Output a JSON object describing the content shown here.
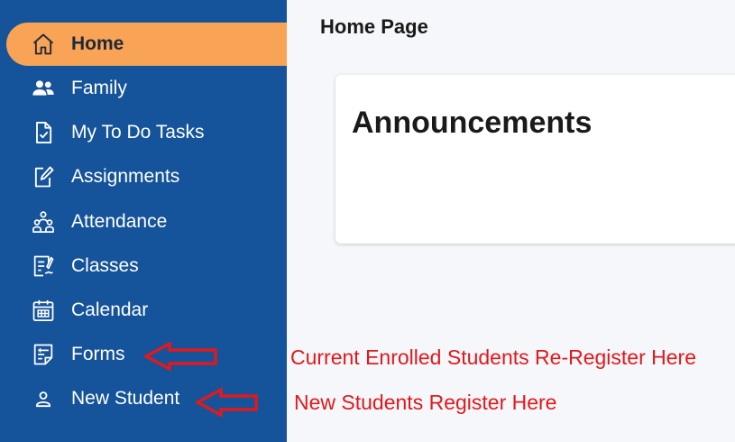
{
  "sidebar": {
    "items": [
      {
        "label": "Home",
        "icon": "home-icon",
        "active": true
      },
      {
        "label": "Family",
        "icon": "family-icon"
      },
      {
        "label": "My To Do Tasks",
        "icon": "checklist-icon"
      },
      {
        "label": "Assignments",
        "icon": "edit-document-icon"
      },
      {
        "label": "Attendance",
        "icon": "people-group-icon"
      },
      {
        "label": "Classes",
        "icon": "document-pen-icon"
      },
      {
        "label": "Calendar",
        "icon": "calendar-icon"
      },
      {
        "label": "Forms",
        "icon": "form-icon"
      },
      {
        "label": "New Student",
        "icon": "person-icon"
      }
    ],
    "colors": {
      "background": "#15539a",
      "active": "#f8a356"
    }
  },
  "header": {
    "title": "Home Page"
  },
  "announcements": {
    "title": "Announcements"
  },
  "annotations": {
    "forms_note": "Current Enrolled Students Re-Register Here",
    "new_student_note": "New Students Register Here",
    "color": "#e0191c"
  }
}
